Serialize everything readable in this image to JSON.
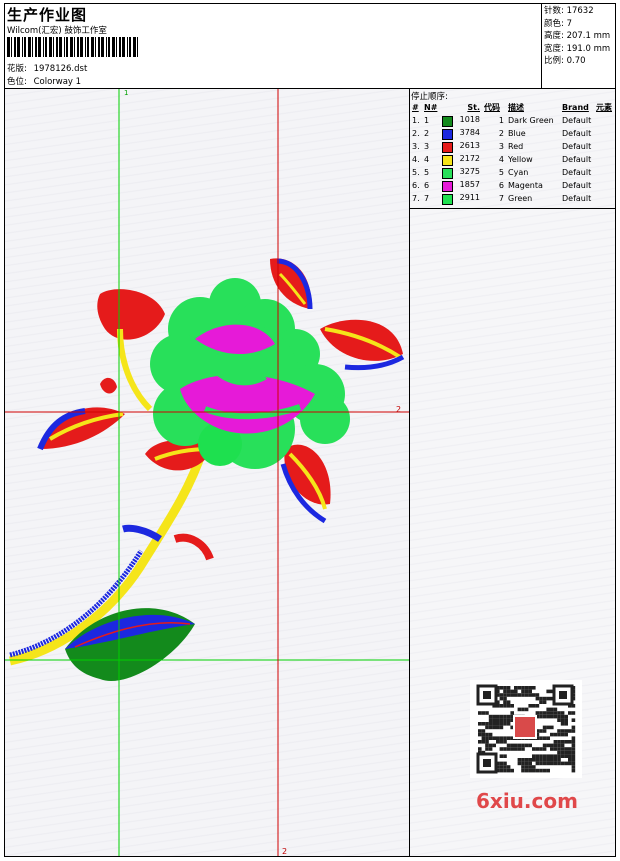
{
  "header": {
    "title": "生产作业图",
    "subtitle": "Wilcom(汇宏) 鼓饰工作室",
    "design_label": "花版:",
    "design_value": "1978126.dst",
    "color_label": "色位:",
    "color_value": "Colorway 1"
  },
  "stats": [
    {
      "label": "针数:",
      "value": "17632"
    },
    {
      "label": "颜色:",
      "value": "7"
    },
    {
      "label": "高度:",
      "value": "207.1 mm"
    },
    {
      "label": "宽度:",
      "value": "191.0 mm"
    },
    {
      "label": "比例:",
      "value": "0.70"
    }
  ],
  "stop_sequence": {
    "title": "停止顺序:",
    "columns": [
      "#",
      "N#",
      "St.",
      "代码",
      "描述",
      "Brand",
      "元素"
    ],
    "rows": [
      {
        "idx": "1.",
        "n": "1",
        "color": "#138a1c",
        "st": "1018",
        "code": "1",
        "desc": "Dark Green",
        "brand": "Default"
      },
      {
        "idx": "2.",
        "n": "2",
        "color": "#1c28e0",
        "st": "3784",
        "code": "2",
        "desc": "Blue",
        "brand": "Default"
      },
      {
        "idx": "3.",
        "n": "3",
        "color": "#e51b1b",
        "st": "2613",
        "code": "3",
        "desc": "Red",
        "brand": "Default"
      },
      {
        "idx": "4.",
        "n": "4",
        "color": "#f5e51a",
        "st": "2172",
        "code": "4",
        "desc": "Yellow",
        "brand": "Default"
      },
      {
        "idx": "5.",
        "n": "5",
        "color": "#28e05a",
        "st": "3275",
        "code": "5",
        "desc": "Cyan",
        "brand": "Default"
      },
      {
        "idx": "6.",
        "n": "6",
        "color": "#e61ad8",
        "st": "1857",
        "code": "6",
        "desc": "Magenta",
        "brand": "Default"
      },
      {
        "idx": "7.",
        "n": "7",
        "color": "#1ee04f",
        "st": "2911",
        "code": "7",
        "desc": "Green",
        "brand": "Default"
      }
    ]
  },
  "guides": {
    "top_marker": "1",
    "right_marker": "2",
    "bottom_marker": "2",
    "guide_color_green": "#00d000",
    "guide_color_red": "#d00000"
  },
  "watermark": {
    "text": "6xiu.com"
  }
}
